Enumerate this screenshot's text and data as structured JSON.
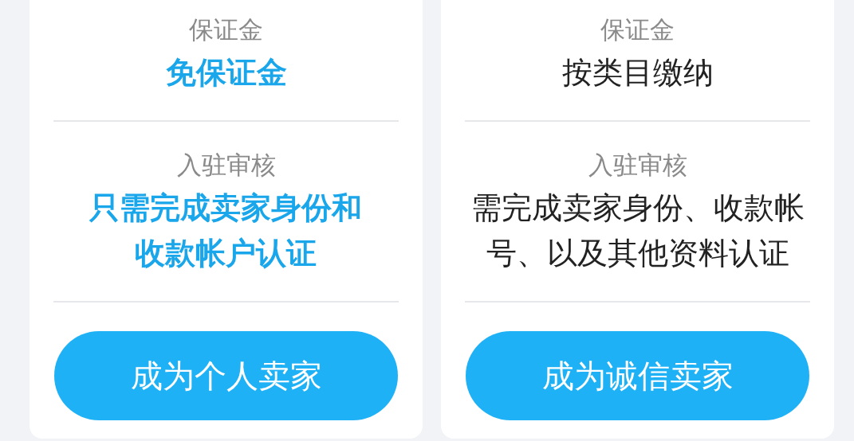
{
  "cards": [
    {
      "highlight": true,
      "rows": [
        {
          "label": "保证金",
          "value": "免保证金"
        },
        {
          "label": "入驻审核",
          "value": "只需完成卖家身份和收款帐户认证"
        }
      ],
      "button": "成为个人卖家"
    },
    {
      "highlight": false,
      "rows": [
        {
          "label": "保证金",
          "value": "按类目缴纳"
        },
        {
          "label": "入驻审核",
          "value": "需完成卖家身份、收款帐号、以及其他资料认证"
        }
      ],
      "button": "成为诚信卖家"
    }
  ]
}
